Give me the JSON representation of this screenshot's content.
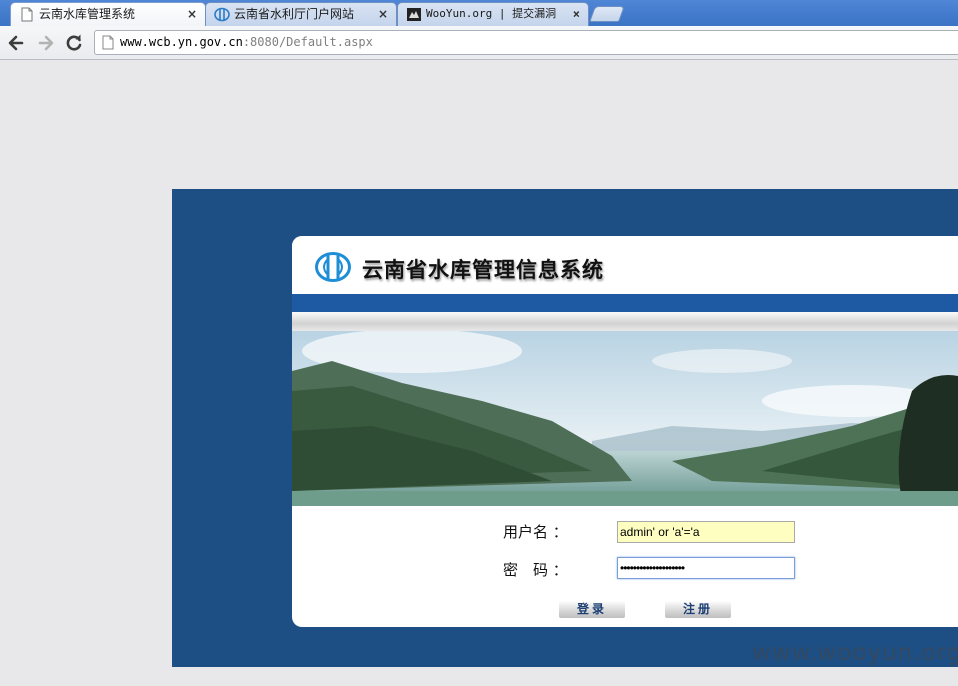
{
  "browser": {
    "tabs": [
      {
        "title": "云南水库管理系统",
        "active": true,
        "icon": "page-icon"
      },
      {
        "title": "云南省水利厅门户网站",
        "active": false,
        "icon": "site-logo-icon"
      },
      {
        "title": "WooYun.org | 提交漏洞",
        "active": false,
        "icon": "wooyun-icon"
      }
    ],
    "close_glyph": "×",
    "url_host": "www.wcb.yn.gov.cn",
    "url_rest": ":8080/Default.aspx"
  },
  "page": {
    "system_title": "云南省水库管理信息系统",
    "username_label": "用户名 ：",
    "password_label": "密　码 ：",
    "username_value": "admin' or 'a'='a",
    "password_value": "••••••••••••••••••••",
    "login_button": "登录",
    "register_button": "注册"
  },
  "watermark": "www.wooyun.org",
  "colors": {
    "page_bg": "#e8e8ea",
    "panel_blue": "#1d4f85",
    "bar_blue": "#1d5aa3",
    "username_field_bg": "#fefec0",
    "button_text": "#1d3f73"
  }
}
